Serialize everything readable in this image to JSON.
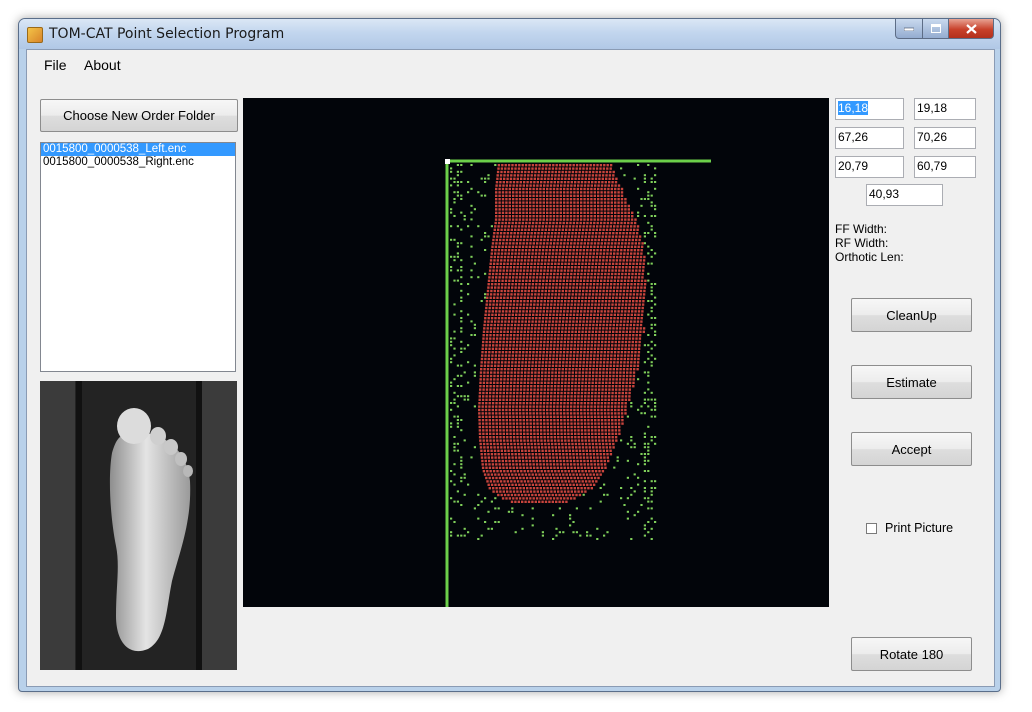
{
  "window": {
    "title": "TOM-CAT Point Selection Program",
    "controls": {
      "minimize_icon": "minimize-icon",
      "maximize_icon": "maximize-icon",
      "close_icon": "close-icon"
    }
  },
  "menu": {
    "items": [
      {
        "label": "File"
      },
      {
        "label": "About"
      }
    ]
  },
  "left_panel": {
    "choose_folder_label": "Choose New Order Folder",
    "files": [
      {
        "name": "0015800_0000538_Left.enc",
        "selected": true
      },
      {
        "name": "0015800_0000538_Right.enc",
        "selected": false
      }
    ],
    "photo": "foot-sole-photo"
  },
  "coordinates": {
    "row1_left": "16,18",
    "row1_right": "19,18",
    "row2_left": "67,26",
    "row2_right": "70,26",
    "row3_left": "20,79",
    "row3_right": "60,79",
    "center": "40,93"
  },
  "measurements": {
    "ff_width_label": "FF Width:",
    "rf_width_label": "RF Width:",
    "orthotic_len_label": "Orthotic Len:"
  },
  "actions": {
    "cleanup_label": "CleanUp",
    "estimate_label": "Estimate",
    "accept_label": "Accept",
    "rotate_label": "Rotate 180"
  },
  "print_picture": {
    "label": "Print Picture",
    "checked": false
  },
  "colors": {
    "canvas_bg": "#02050a",
    "foot_points": "#c8443c",
    "noise_points": "#7fcf5a",
    "guide_lines": "#6cd04a",
    "selection": "#3399ff"
  }
}
